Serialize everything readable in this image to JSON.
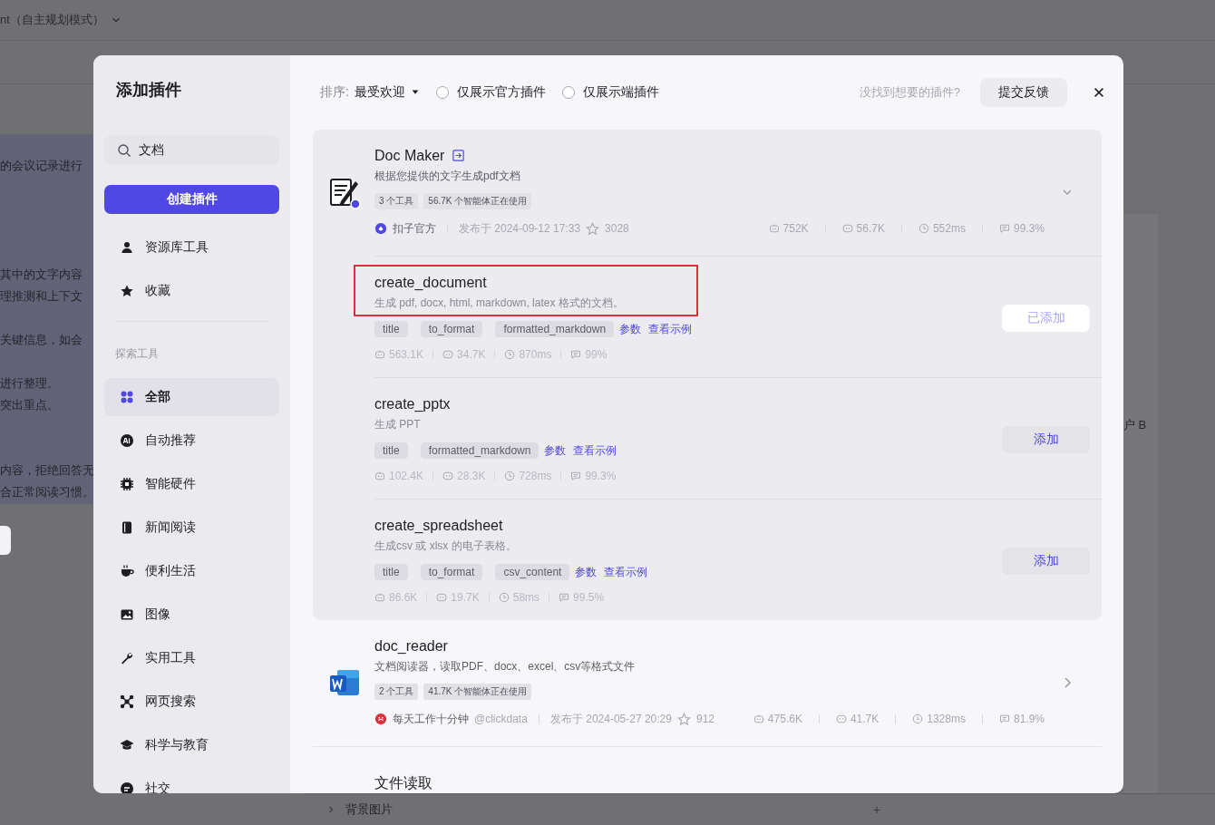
{
  "background": {
    "header_title": "nt（自主规划模式）",
    "left_lines": [
      "的会议记录进行",
      "其中的文字内容",
      "理推测和上下文",
      "关键信息，如会",
      "进行整理。",
      "突出重点。",
      "内容，拒绝回答无",
      "合正常阅读习惯。"
    ],
    "right_text": "户 B",
    "bottom_section": "背景图片",
    "bottom_add": "+"
  },
  "dialog": {
    "title": "添加插件",
    "search": {
      "value": "文档"
    },
    "create_button": "创建插件",
    "library_items": [
      {
        "label": "资源库工具",
        "selected": false
      },
      {
        "label": "收藏",
        "selected": false
      }
    ],
    "section_label": "探索工具",
    "categories": [
      {
        "label": "全部",
        "selected": true
      },
      {
        "label": "自动推荐",
        "selected": false
      },
      {
        "label": "智能硬件",
        "selected": false
      },
      {
        "label": "新闻阅读",
        "selected": false
      },
      {
        "label": "便利生活",
        "selected": false
      },
      {
        "label": "图像",
        "selected": false
      },
      {
        "label": "实用工具",
        "selected": false
      },
      {
        "label": "网页搜索",
        "selected": false
      },
      {
        "label": "科学与教育",
        "selected": false
      },
      {
        "label": "社交",
        "selected": false
      }
    ],
    "sort": {
      "label": "排序:",
      "value": "最受欢迎"
    },
    "filters": [
      {
        "label": "仅展示官方插件",
        "checked": false
      },
      {
        "label": "仅展示端插件",
        "checked": false
      }
    ],
    "feedback_hint": "没找到想要的插件?",
    "feedback_button": "提交反馈",
    "plugins": [
      {
        "kind": "document",
        "name": "Doc Maker",
        "description": "根据您提供的文字生成pdf文档",
        "tags": [
          "3 个工具",
          "56.7K 个智能体正在使用"
        ],
        "publisher": "扣子官方",
        "published": "发布于 2024-09-12 17:33",
        "favorites": "3028",
        "stats": [
          "752K",
          "56.7K",
          "552ms",
          "99.3%"
        ],
        "expanded": true,
        "tools": [
          {
            "name": "create_document",
            "description": "生成 pdf, docx, html, markdown, latex 格式的文档。",
            "params": [
              "title",
              "to_format",
              "formatted_markdown"
            ],
            "params_link": "参数",
            "example_link": "查看示例",
            "stats": [
              "563.1K",
              "34.7K",
              "870ms",
              "99%"
            ],
            "added": true,
            "button": "已添加",
            "highlighted": true
          },
          {
            "name": "create_pptx",
            "description": "生成 PPT",
            "params": [
              "title",
              "formatted_markdown"
            ],
            "params_link": "参数",
            "example_link": "查看示例",
            "stats": [
              "102.4K",
              "28.3K",
              "728ms",
              "99.3%"
            ],
            "added": false,
            "button": "添加",
            "highlighted": false
          },
          {
            "name": "create_spreadsheet",
            "description": "生成csv 或 xlsx 的电子表格。",
            "params": [
              "title",
              "to_format",
              "csv_content"
            ],
            "params_link": "参数",
            "example_link": "查看示例",
            "stats": [
              "86.6K",
              "19.7K",
              "58ms",
              "99.5%"
            ],
            "added": false,
            "button": "添加",
            "highlighted": false
          }
        ]
      },
      {
        "kind": "word",
        "name": "doc_reader",
        "description": "文档阅读器，读取PDF、docx、excel、csv等格式文件",
        "tags": [
          "2 个工具",
          "41.7K 个智能体正在使用"
        ],
        "publisher": "每天工作十分钟",
        "publisher_handle": "@clickdata",
        "published": "发布于 2024-05-27 20:29",
        "favorites": "912",
        "stats": [
          "475.6K",
          "41.7K",
          "1328ms",
          "81.9%"
        ],
        "expanded": false
      },
      {
        "kind": "plain",
        "name": "文件读取",
        "expanded": false
      }
    ]
  }
}
